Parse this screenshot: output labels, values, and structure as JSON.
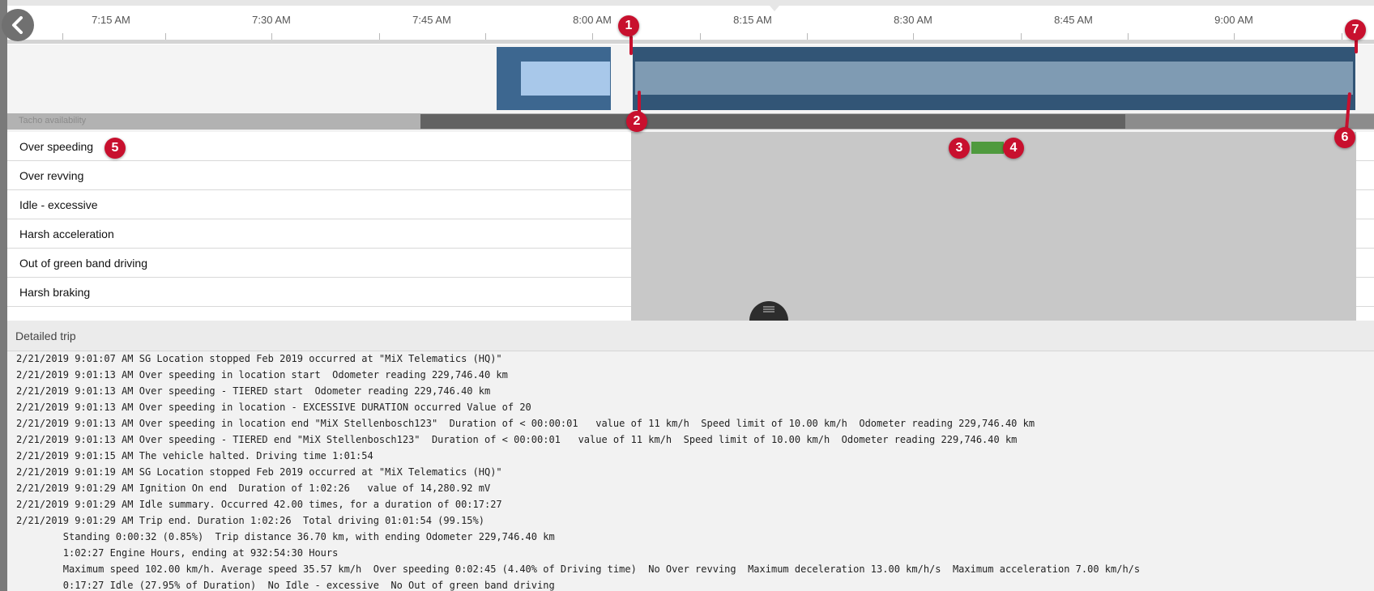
{
  "timeline": {
    "tick_labels": [
      "7:15 AM",
      "7:30 AM",
      "7:45 AM",
      "8:00 AM",
      "8:15 AM",
      "8:30 AM",
      "8:45 AM",
      "9:00 AM"
    ],
    "tacho_label": "Tacho availability"
  },
  "event_rows": [
    {
      "label": "Over speeding"
    },
    {
      "label": "Over revving"
    },
    {
      "label": "Idle - excessive"
    },
    {
      "label": "Harsh acceleration"
    },
    {
      "label": "Out of green band driving"
    },
    {
      "label": "Harsh braking"
    }
  ],
  "detail": {
    "title": "Detailed trip",
    "lines": [
      "2/21/2019 9:01:07 AM SG Location stopped Feb 2019 occurred at \"MiX Telematics (HQ)\"",
      "2/21/2019 9:01:13 AM Over speeding in location start  Odometer reading 229,746.40 km",
      "2/21/2019 9:01:13 AM Over speeding - TIERED start  Odometer reading 229,746.40 km",
      "2/21/2019 9:01:13 AM Over speeding in location - EXCESSIVE DURATION occurred Value of 20",
      "2/21/2019 9:01:13 AM Over speeding in location end \"MiX Stellenbosch123\"  Duration of < 00:00:01   value of 11 km/h  Speed limit of 10.00 km/h  Odometer reading 229,746.40 km",
      "2/21/2019 9:01:13 AM Over speeding - TIERED end \"MiX Stellenbosch123\"  Duration of < 00:00:01   value of 11 km/h  Speed limit of 10.00 km/h  Odometer reading 229,746.40 km",
      "2/21/2019 9:01:15 AM The vehicle halted. Driving time 1:01:54",
      "2/21/2019 9:01:19 AM SG Location stopped Feb 2019 occurred at \"MiX Telematics (HQ)\"",
      "2/21/2019 9:01:29 AM Ignition On end  Duration of 1:02:26   value of 14,280.92 mV",
      "2/21/2019 9:01:29 AM Idle summary. Occurred 42.00 times, for a duration of 00:17:27",
      "2/21/2019 9:01:29 AM Trip end. Duration 1:02:26  Total driving 01:01:54 (99.15%)",
      "        Standing 0:00:32 (0.85%)  Trip distance 36.70 km, with ending Odometer 229,746.40 km",
      "        1:02:27 Engine Hours, ending at 932:54:30 Hours",
      "        Maximum speed 102.00 km/h. Average speed 35.57 km/h  Over speeding 0:02:45 (4.40% of Driving time)  No Over revving  Maximum deceleration 13.00 km/h/s  Maximum acceleration 7.00 km/h/s",
      "        0:17:27 Idle (27.95% of Duration)  No Idle - excessive  No Out of green band driving"
    ]
  },
  "markers": [
    "1",
    "2",
    "3",
    "4",
    "5",
    "6",
    "7"
  ],
  "icons": {
    "back": "chevron-left-icon",
    "handle": "drag-handle-icon"
  },
  "colors": {
    "trip_dark": "#325576",
    "trip_light": "#7f9bb3",
    "event_green": "#4f9a3e",
    "marker_red": "#c8102e"
  }
}
